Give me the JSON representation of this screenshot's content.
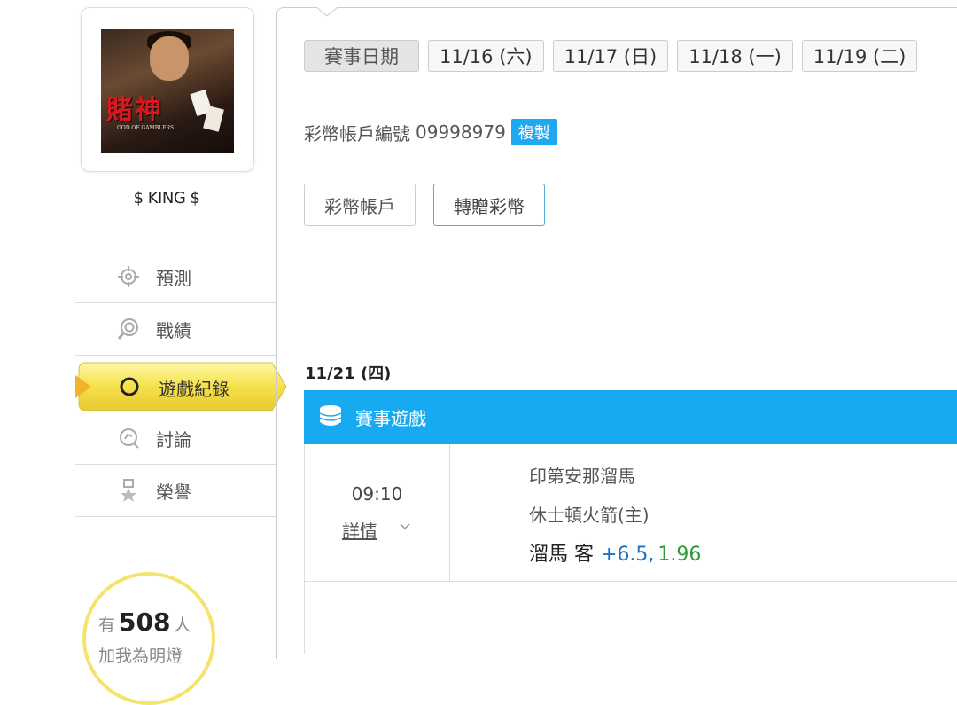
{
  "profile": {
    "poster_title": "賭神",
    "poster_subtitle": "GOD OF GAMBLERS",
    "username": "$ KING $"
  },
  "menu": [
    {
      "label": "預測",
      "icon": "target-icon"
    },
    {
      "label": "戰績",
      "icon": "record-icon"
    },
    {
      "label": "遊戲紀錄",
      "icon": "circle-icon",
      "active": true
    },
    {
      "label": "討論",
      "icon": "chat-icon"
    },
    {
      "label": "榮譽",
      "icon": "medal-icon"
    }
  ],
  "fans": {
    "prefix": "有",
    "count": "508",
    "unit": "人",
    "suffix": "加我為明燈"
  },
  "dates": {
    "label": "賽事日期",
    "items": [
      "11/16 (六)",
      "11/17 (日)",
      "11/18 (一)",
      "11/19 (二)"
    ]
  },
  "account": {
    "label": "彩幣帳戶編號",
    "number": "09998979",
    "copy_label": "複製"
  },
  "actions": {
    "account_tab": "彩幣帳戶",
    "transfer_tab": "轉贈彩幣"
  },
  "section": {
    "date": "11/21 (四)",
    "game_title": "賽事遊戲"
  },
  "game": {
    "time": "09:10",
    "detail_label": "詳情",
    "team_away": "印第安那溜馬",
    "team_home": "休士頓火箭(主)",
    "bet_pick": "溜馬 客",
    "bet_handicap": "+6.5,",
    "bet_odds": "1.96"
  },
  "colors": {
    "accent": "#18aaf0",
    "active_tab": "#f5e14a",
    "handicap": "#1a73c4",
    "odds": "#2e9a3a"
  }
}
